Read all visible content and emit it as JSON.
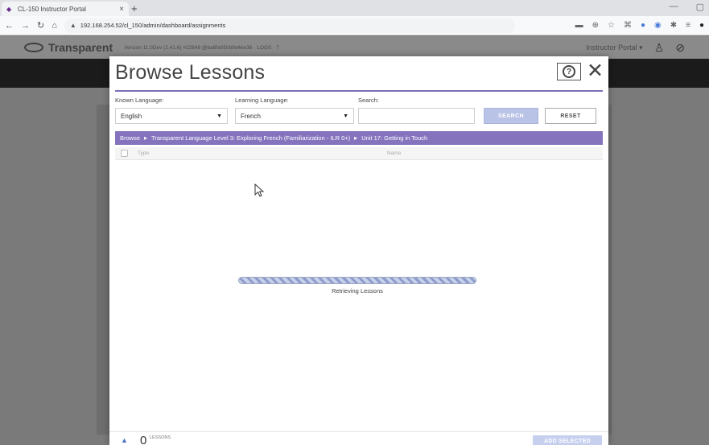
{
  "browser": {
    "tab_title": "CL-150 Instructor Portal",
    "url": "192.168.254.52/cl_150/admin/dashboard/assignments"
  },
  "app": {
    "brand": "Transparent",
    "version_text": "Version 11.0Dev (2.41.6) #22648 @ba8fa050b9d4ee36 · LOGS · 7",
    "portal_menu": "Instructor Portal ▾"
  },
  "modal": {
    "title": "Browse Lessons",
    "known_language_label": "Known Language:",
    "known_language_value": "English",
    "learning_language_label": "Learning Language:",
    "learning_language_value": "French",
    "search_label": "Search:",
    "search_value": "",
    "search_button": "SEARCH",
    "reset_button": "RESET",
    "breadcrumb": [
      "Browse",
      "Transparent Language Level 3: Exploring French (Familiarization - ILR 0+)",
      "Unit 17: Getting in Touch"
    ],
    "columns": {
      "type": "Type",
      "name": "Name"
    },
    "loading_text": "Retrieving Lessons",
    "loading_progress": "indeterminate",
    "footer": {
      "count": "0",
      "count_label": "LESSONS",
      "add_button": "ADD SELECTED"
    }
  },
  "colors": {
    "accent_purple": "#8574bd",
    "search_button_bg": "#b9c3e6",
    "overlay_gray": "#7a7a7a"
  }
}
